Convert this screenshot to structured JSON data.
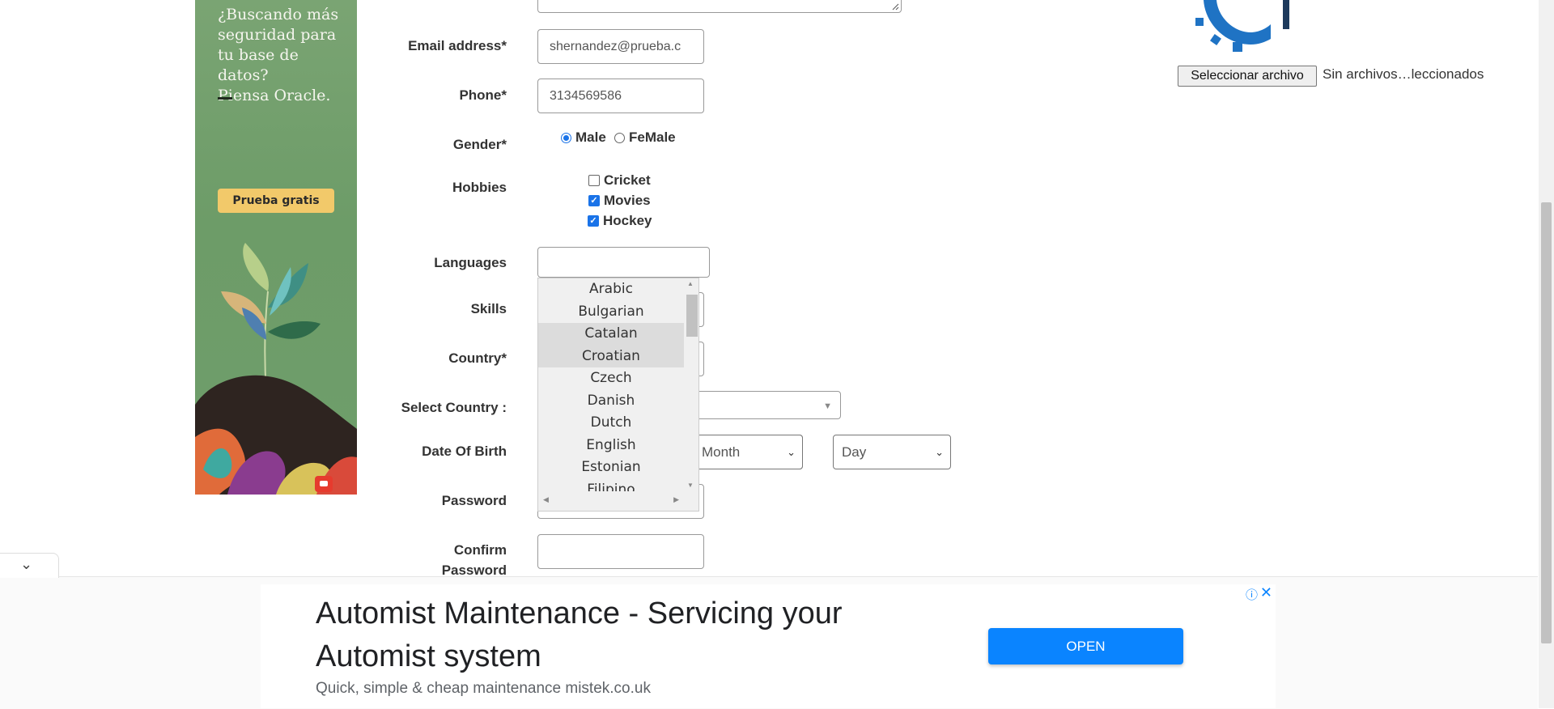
{
  "side_ad": {
    "text_line1": "¿Buscando más",
    "text_line2": "seguridad para",
    "text_line3": "tu base de datos?",
    "text_line4": "Piensa Oracle.",
    "cta_label": "Prueba gratis",
    "accent_color": "#f2c96a",
    "background_color": "#6f9e6b"
  },
  "form": {
    "email": {
      "label": "Email address*",
      "value": "shernandez@prueba.c"
    },
    "phone": {
      "label": "Phone*",
      "value": "3134569586"
    },
    "gender": {
      "label": "Gender*",
      "options": [
        "Male",
        "FeMale"
      ],
      "selected": "Male"
    },
    "hobbies": {
      "label": "Hobbies",
      "items": [
        {
          "label": "Cricket",
          "checked": false
        },
        {
          "label": "Movies",
          "checked": true
        },
        {
          "label": "Hockey",
          "checked": true
        }
      ]
    },
    "languages": {
      "label": "Languages",
      "value": "",
      "options": [
        "Arabic",
        "Bulgarian",
        "Catalan",
        "Croatian",
        "Czech",
        "Danish",
        "Dutch",
        "English",
        "Estonian",
        "Filipino"
      ],
      "highlighted": [
        "Catalan",
        "Croatian"
      ]
    },
    "skills": {
      "label": "Skills"
    },
    "country": {
      "label": "Country*"
    },
    "select_country": {
      "label": "Select Country :"
    },
    "dob": {
      "label": "Date Of Birth",
      "month_placeholder": "Month",
      "day_placeholder": "Day"
    },
    "password": {
      "label": "Password"
    },
    "confirm_password": {
      "label_line1": "Confirm",
      "label_line2": "Password"
    }
  },
  "file_upload": {
    "button_label": "Seleccionar archivo",
    "status": "Sin archivos…leccionados"
  },
  "bottom_ad": {
    "title": "Automist Maintenance - Servicing your Automist system",
    "subtitle": "Quick, simple & cheap maintenance mistek.co.uk",
    "open_label": "OPEN",
    "info_icon": "ⓘ",
    "close_icon": "✕",
    "button_color": "#0a84ff"
  },
  "collapse_icon": "⌄"
}
